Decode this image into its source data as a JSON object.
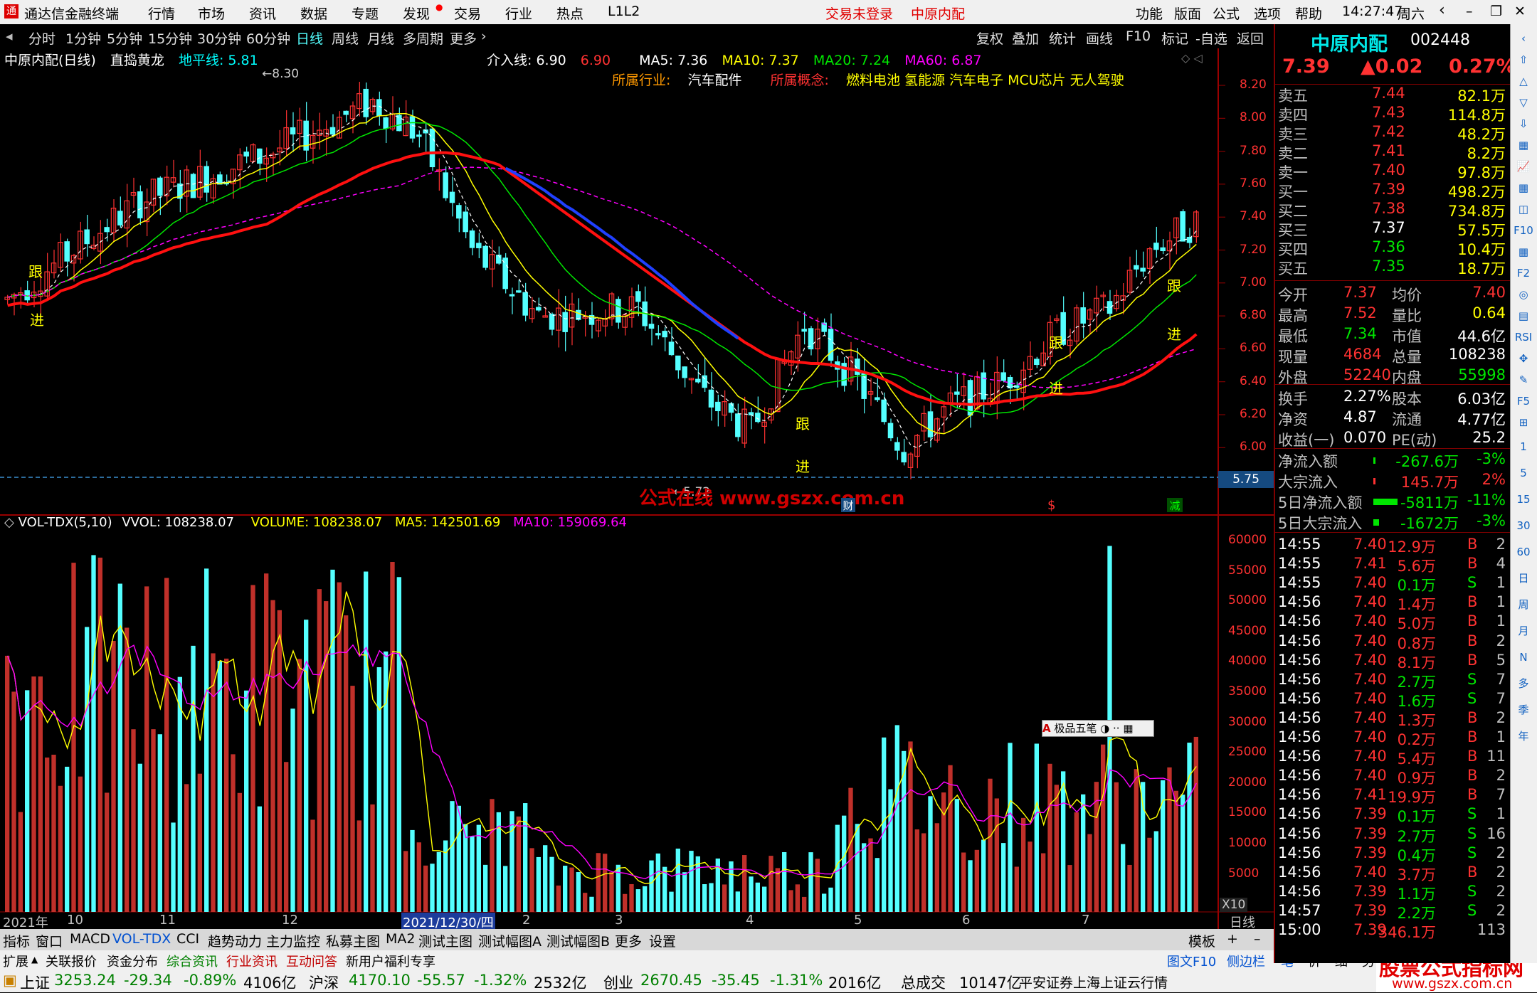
{
  "menubar": {
    "app_title": "通达信金融终端",
    "items": [
      "行情",
      "市场",
      "资讯",
      "数据",
      "专题",
      "发现",
      "交易",
      "行业",
      "热点",
      "L1L2"
    ],
    "login_status": "交易未登录",
    "stock_name": "中原内配",
    "right_items": [
      "功能",
      "版面",
      "公式",
      "选项",
      "帮助"
    ],
    "time": "14:27:47",
    "weekday": "周六"
  },
  "periods": [
    "分时",
    "1分钟",
    "5分钟",
    "15分钟",
    "30分钟",
    "60分钟",
    "日线",
    "周线",
    "月线",
    "多周期",
    "更多"
  ],
  "active_period": "日线",
  "toolbar_right": [
    "复权",
    "叠加",
    "统计",
    "画线",
    "F10",
    "标记",
    "-自选",
    "返回"
  ],
  "chart_header": {
    "name": "中原内配(日线)",
    "indicator": "直捣黄龙",
    "horizon_label": "地平线: 5.81",
    "entry_label": "介入线: 6.90",
    "entry_value": "6.90",
    "ma5": "MA5: 7.36",
    "ma10": "MA10: 7.37",
    "ma20": "MA20: 7.24",
    "ma60": "MA60: 6.87",
    "industry_label": "所属行业:",
    "industry": "汽车配件",
    "concept_label": "所属概念:",
    "concepts": "燃料电池 氢能源 汽车电子 MCU芯片 无人驾驶",
    "watermark": "公式在线  www.gszx.com.cn",
    "baseline_value": "5.75",
    "high_mark": "8.30",
    "low_mark": "5.72",
    "signals": [
      "跟",
      "进",
      "跟",
      "进",
      "跟",
      "进",
      "跟",
      "进"
    ]
  },
  "price_axis": [
    "8.20",
    "8.00",
    "7.80",
    "7.60",
    "7.40",
    "7.20",
    "7.00",
    "6.80",
    "6.60",
    "6.40",
    "6.20",
    "6.00"
  ],
  "vol_header": {
    "name": "VOL-TDX(5,10)",
    "vvol": "VVOL: 108238.07",
    "volume": "VOLUME: 108238.07",
    "ma5": "MA5: 142501.69",
    "ma10": "MA10: 159069.64"
  },
  "vol_axis": [
    "60000",
    "55000",
    "50000",
    "45000",
    "40000",
    "35000",
    "30000",
    "25000",
    "20000",
    "15000",
    "10000",
    "5000"
  ],
  "vol_unit": "X10",
  "ime_label": "极品五笔",
  "date_axis": [
    "2021年",
    "10",
    "11",
    "12",
    "2021/12/30/四",
    "2",
    "3",
    "4",
    "5",
    "6",
    "7"
  ],
  "date_axis_right": "日线",
  "event_marks": [
    "财",
    "$",
    "减"
  ],
  "indicator_tabs": [
    "指标",
    "窗口",
    "MACD",
    "VOL-TDX",
    "CCI",
    "趋势动力",
    "主力监控",
    "私募主图",
    "MA2",
    "测试主图",
    "测试幅图A",
    "测试幅图B",
    "更多",
    "设置"
  ],
  "template_label": "模板",
  "sub_tabs": [
    "扩展",
    "关联报价",
    "资金分布",
    "综合资讯",
    "行业资讯",
    "互动问答",
    "新用户福利专享"
  ],
  "sub_right": [
    "图文F10",
    "侧边栏",
    "笔",
    "价",
    "细",
    "势"
  ],
  "quote": {
    "name": "中原内配",
    "code": "002448",
    "price": "7.39",
    "change": "▲0.02",
    "pct": "0.27%",
    "asks": [
      {
        "label": "卖五",
        "price": "7.44",
        "vol": "82.1万"
      },
      {
        "label": "卖四",
        "price": "7.43",
        "vol": "114.8万"
      },
      {
        "label": "卖三",
        "price": "7.42",
        "vol": "48.2万"
      },
      {
        "label": "卖二",
        "price": "7.41",
        "vol": "8.2万"
      },
      {
        "label": "卖一",
        "price": "7.40",
        "vol": "97.8万"
      }
    ],
    "bids": [
      {
        "label": "买一",
        "price": "7.39",
        "vol": "498.2万"
      },
      {
        "label": "买二",
        "price": "7.38",
        "vol": "734.8万"
      },
      {
        "label": "买三",
        "price": "7.37",
        "vol": "57.5万"
      },
      {
        "label": "买四",
        "price": "7.36",
        "vol": "10.4万"
      },
      {
        "label": "买五",
        "price": "7.35",
        "vol": "18.7万"
      }
    ],
    "stats": [
      {
        "l1": "今开",
        "v1": "7.37",
        "l2": "均价",
        "v2": "7.40"
      },
      {
        "l1": "最高",
        "v1": "7.52",
        "l2": "量比",
        "v2": "0.64"
      },
      {
        "l1": "最低",
        "v1": "7.34",
        "l2": "市值",
        "v2": "44.6亿"
      },
      {
        "l1": "现量",
        "v1": "4684",
        "l2": "总量",
        "v2": "108238"
      },
      {
        "l1": "外盘",
        "v1": "52240",
        "l2": "内盘",
        "v2": "55998"
      }
    ],
    "fund": [
      {
        "l1": "换手",
        "v1": "2.27%",
        "l2": "股本",
        "v2": "6.03亿"
      },
      {
        "l1": "净资",
        "v1": "4.87",
        "l2": "流通",
        "v2": "4.77亿"
      },
      {
        "l1": "收益(一)",
        "v1": "0.070",
        "l2": "PE(动)",
        "v2": "25.2"
      }
    ],
    "flows": [
      {
        "label": "净流入额",
        "value": "-267.6万",
        "pct": "-3%"
      },
      {
        "label": "大宗流入",
        "value": "145.7万",
        "pct": "2%"
      },
      {
        "label": "5日净流入额",
        "value": "-5811万",
        "pct": "-11%"
      },
      {
        "label": "5日大宗流入",
        "value": "-1672万",
        "pct": "-3%"
      }
    ],
    "ticks": [
      [
        "14:55",
        "7.40",
        "12.9万",
        "B",
        "2"
      ],
      [
        "14:55",
        "7.41",
        "5.6万",
        "B",
        "4"
      ],
      [
        "14:55",
        "7.40",
        "0.1万",
        "S",
        "1"
      ],
      [
        "14:56",
        "7.40",
        "1.4万",
        "B",
        "1"
      ],
      [
        "14:56",
        "7.40",
        "5.0万",
        "B",
        "1"
      ],
      [
        "14:56",
        "7.40",
        "0.8万",
        "B",
        "2"
      ],
      [
        "14:56",
        "7.40",
        "8.1万",
        "B",
        "5"
      ],
      [
        "14:56",
        "7.40",
        "2.7万",
        "S",
        "7"
      ],
      [
        "14:56",
        "7.40",
        "1.6万",
        "S",
        "7"
      ],
      [
        "14:56",
        "7.40",
        "1.3万",
        "B",
        "2"
      ],
      [
        "14:56",
        "7.40",
        "0.2万",
        "B",
        "1"
      ],
      [
        "14:56",
        "7.40",
        "5.4万",
        "B",
        "11"
      ],
      [
        "14:56",
        "7.40",
        "0.9万",
        "B",
        "2"
      ],
      [
        "14:56",
        "7.41",
        "19.9万",
        "B",
        "7"
      ],
      [
        "14:56",
        "7.39",
        "0.1万",
        "S",
        "1"
      ],
      [
        "14:56",
        "7.39",
        "2.7万",
        "S",
        "16"
      ],
      [
        "14:56",
        "7.39",
        "0.4万",
        "S",
        "2"
      ],
      [
        "14:56",
        "7.40",
        "3.7万",
        "B",
        "2"
      ],
      [
        "14:56",
        "7.39",
        "1.1万",
        "S",
        "2"
      ],
      [
        "14:57",
        "7.39",
        "2.2万",
        "S",
        "2"
      ],
      [
        "15:00",
        "7.39",
        "346.1万",
        "",
        "113"
      ]
    ]
  },
  "side_tool_labels": [
    "1",
    "5",
    "15",
    "30",
    "60",
    "日",
    "周",
    "月",
    "N",
    "多",
    "季",
    "年"
  ],
  "status_bar": {
    "sh_label": "上证",
    "sh": "3253.24",
    "sh_chg": "-29.34",
    "sh_pct": "-0.89%",
    "sh_amt": "4106亿",
    "sz_label": "沪深",
    "sz": "4170.10",
    "sz_chg": "-55.57",
    "sz_pct": "-1.32%",
    "sz_amt": "2532亿",
    "cy_label": "创业",
    "cy": "2670.45",
    "cy_chg": "-35.45",
    "cy_pct": "-1.31%",
    "cy_amt": "2016亿",
    "total_label": "总成交",
    "total": "10147亿",
    "server": "平安证券上海上证云行情"
  },
  "brand_watermark": "股票公式指标网",
  "brand_url": "www.gszx.com.cn",
  "colors": {
    "up": "#ff3232",
    "down": "#54ffff",
    "bg": "#000000",
    "grid": "#800000"
  }
}
